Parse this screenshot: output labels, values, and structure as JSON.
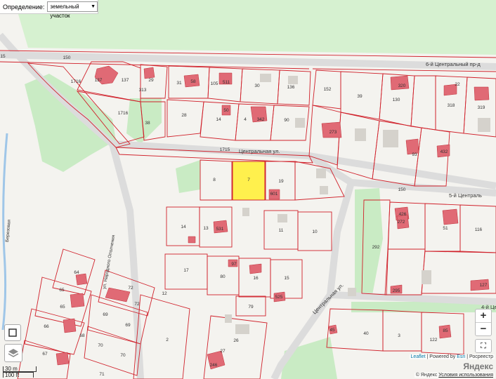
{
  "control": {
    "label": "Определение:",
    "selected": "земельный участок"
  },
  "streets": {
    "tsentralnaya_top": "Центральная ул.",
    "tsentralnaya_diag": "Центральная ул.",
    "proezd6": "6-й Центральный пр-д",
    "proezd5": "5-й Централь",
    "proezd4": "4-й Цен",
    "opolchenie": "ул. Народного Ополчения",
    "berezovaya": "Березовая"
  },
  "parcels": [
    "15",
    "150",
    "137",
    "137",
    "29",
    "313",
    "31",
    "58",
    "105",
    "511",
    "30",
    "136",
    "152",
    "39",
    "320",
    "22",
    "318",
    "319",
    "1716",
    "1716",
    "38",
    "28",
    "14",
    "50",
    "4",
    "342",
    "90",
    "130",
    "273",
    "93",
    "432",
    "1715",
    "8",
    "7",
    "19",
    "601",
    "14",
    "13",
    "531",
    "11",
    "10",
    "150",
    "292",
    "426",
    "272",
    "51",
    "116",
    "17",
    "97",
    "80",
    "16",
    "15",
    "525",
    "79",
    "64",
    "65",
    "65",
    "66",
    "67",
    "72",
    "72",
    "69",
    "69",
    "70",
    "70",
    "71",
    "2",
    "26",
    "27",
    "40",
    "3",
    "122",
    "127",
    "295",
    "246",
    "85",
    "45",
    "68",
    "12"
  ],
  "zoom": {
    "in": "+",
    "out": "−"
  },
  "scale": {
    "m": "30 m",
    "ft": "100 ft"
  },
  "attribution": {
    "leaflet": "Leaflet",
    "sep1": " | Powered by ",
    "esri": "Esri",
    "sep2": " | Росреестр"
  },
  "yandex": "Яндекс",
  "copyright": {
    "text": "© Яндекс",
    "terms": "Условия использования"
  },
  "colors": {
    "parcel": "#d0202a",
    "building": "#e06a75",
    "selected": "#fff04d",
    "green": "#c5ebc1",
    "forest": "#d8f0d0"
  }
}
